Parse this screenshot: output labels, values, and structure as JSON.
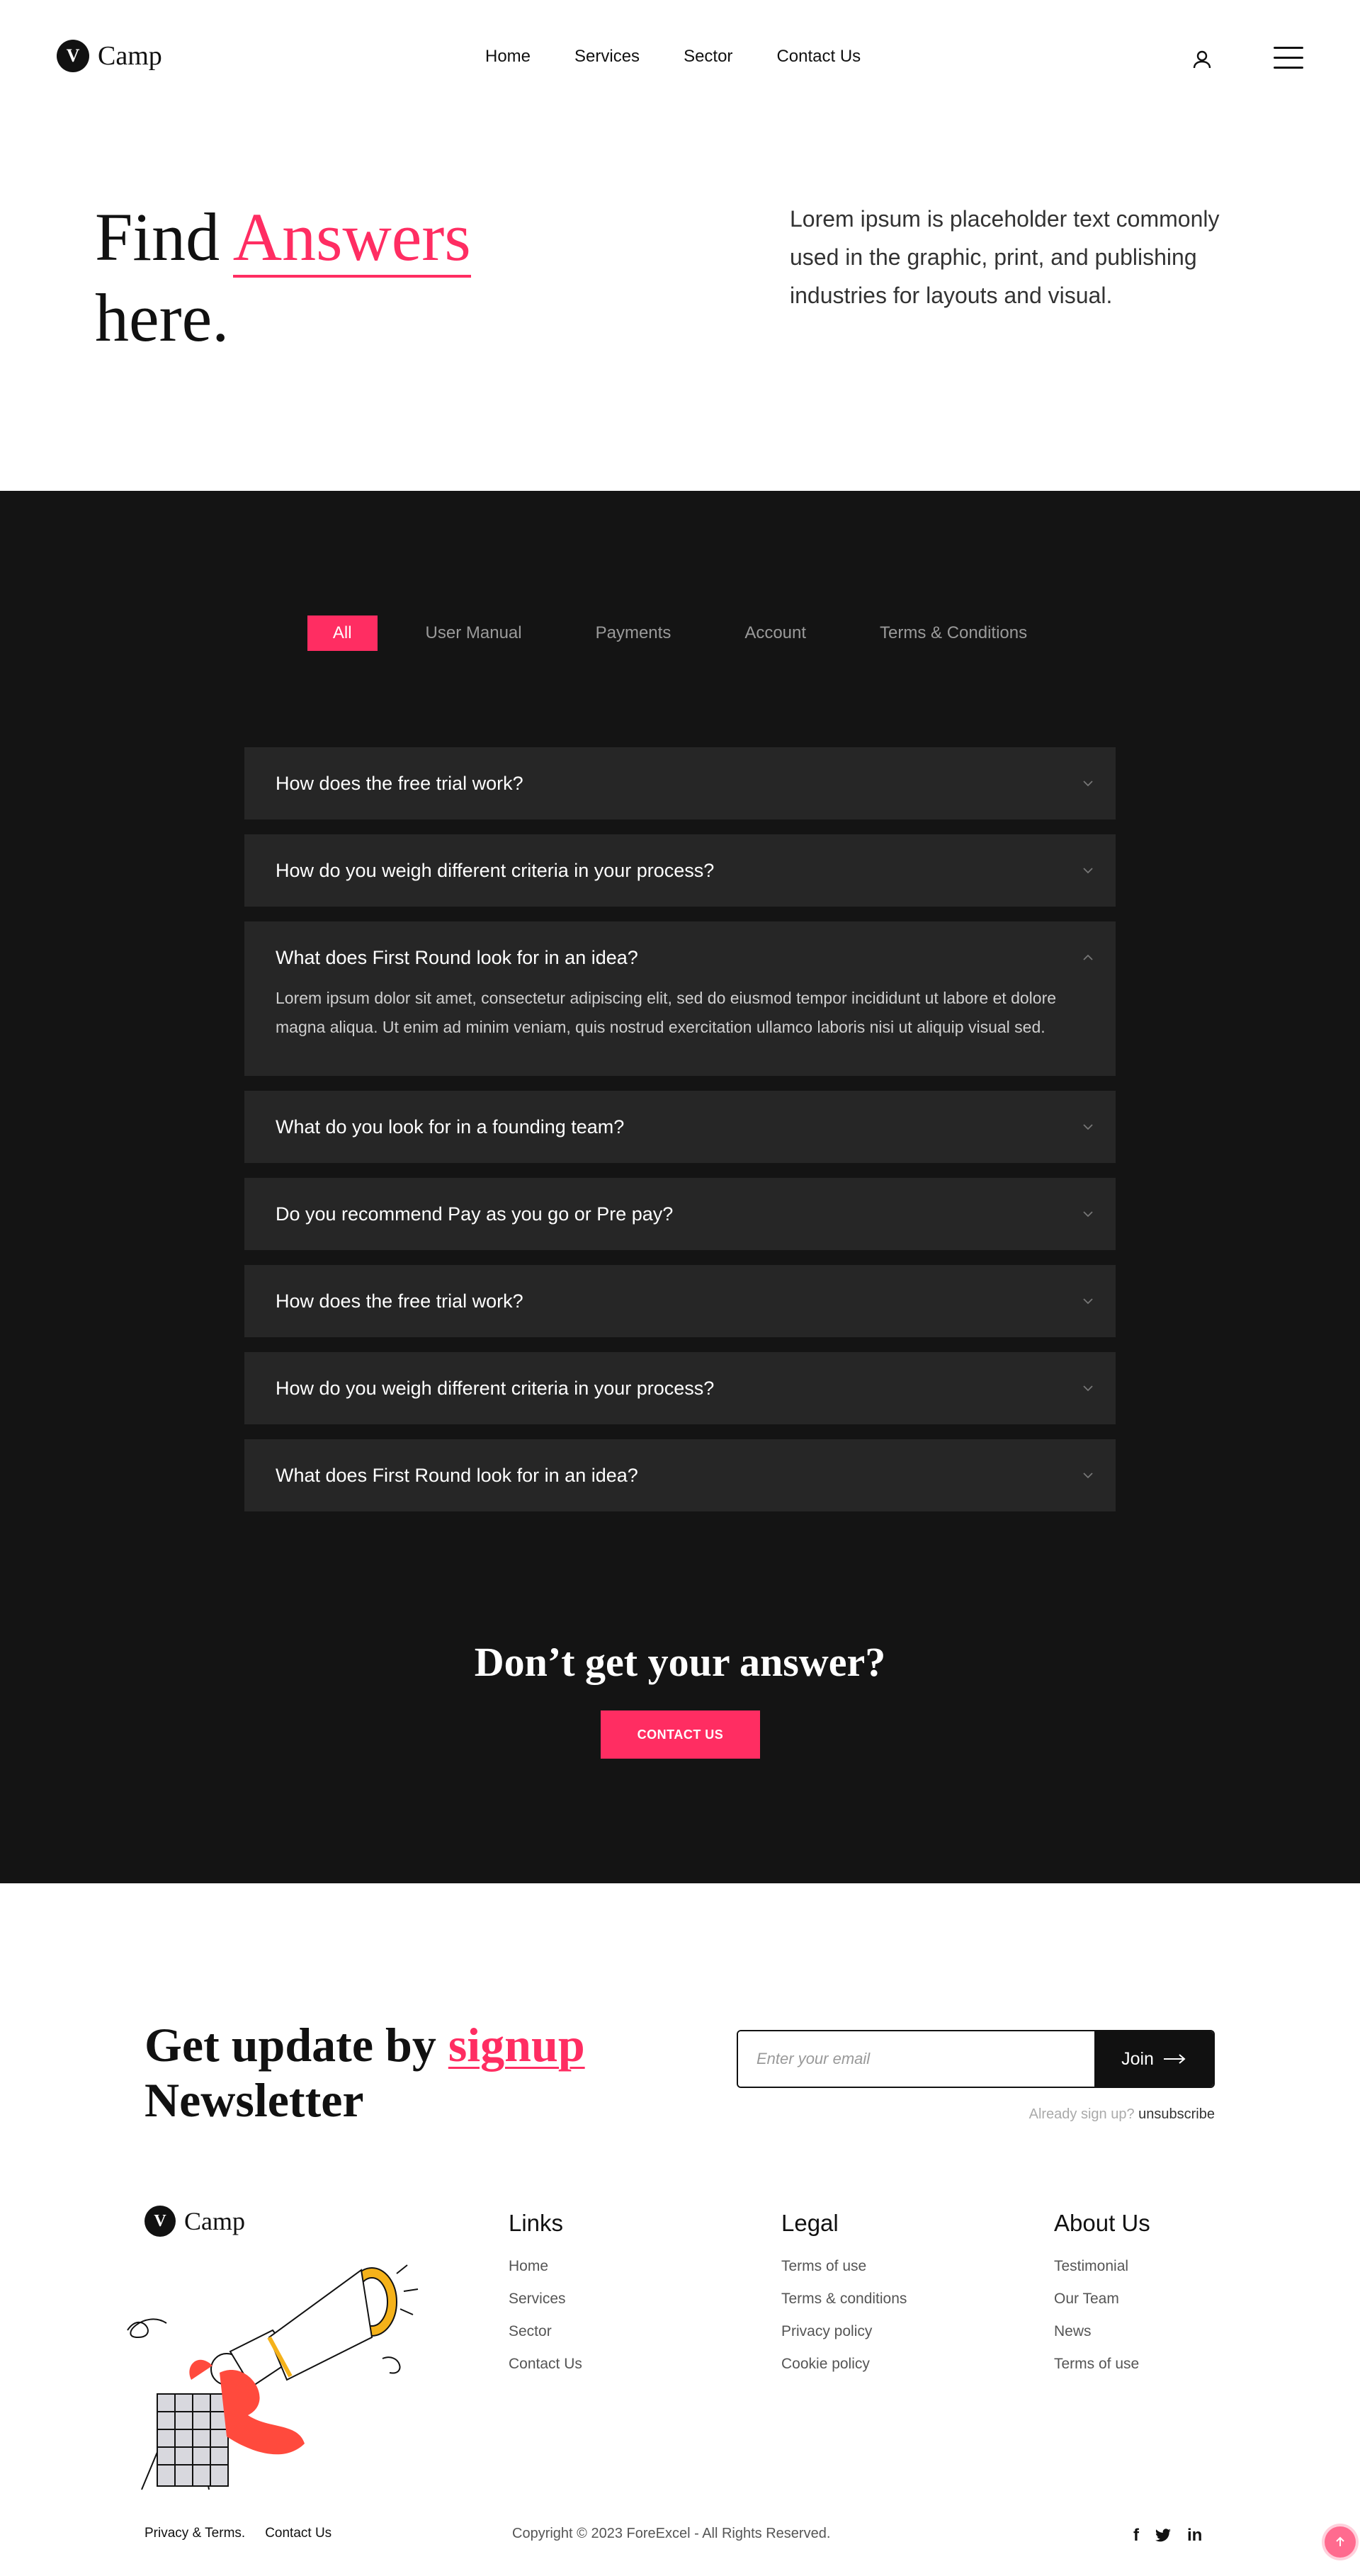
{
  "header": {
    "logo_letter": "V",
    "logo_text": "Camp",
    "nav": [
      "Home",
      "Services",
      "Sector",
      "Contact Us"
    ]
  },
  "hero": {
    "title_part1": "Find",
    "title_accent": "Answers",
    "title_part2": "here.",
    "description": "Lorem ipsum is placeholder text commonly used in the graphic, print, and publishing industries for layouts and visual."
  },
  "faq": {
    "tabs": [
      "All",
      "User Manual",
      "Payments",
      "Account",
      "Terms & Conditions"
    ],
    "active_tab": "All",
    "items": [
      {
        "question": "How does the free trial work?",
        "open": false
      },
      {
        "question": "How do you weigh different criteria in your process?",
        "open": false
      },
      {
        "question": "What does First Round look for in an idea?",
        "open": true,
        "answer": "Lorem ipsum dolor sit amet, consectetur adipiscing elit, sed do eiusmod tempor incididunt ut labore et dolore magna aliqua. Ut enim ad minim veniam, quis nostrud exercitation ullamco laboris nisi ut aliquip visual sed."
      },
      {
        "question": "What do you look for in a founding team?",
        "open": false
      },
      {
        "question": "Do you recommend Pay as you go or Pre pay?",
        "open": false
      },
      {
        "question": "How does the free trial work?",
        "open": false
      },
      {
        "question": "How do you weigh different criteria in your process?",
        "open": false
      },
      {
        "question": "What does First Round look for in an idea?",
        "open": false
      }
    ],
    "cta_title": "Don’t get your answer?",
    "cta_button": "CONTACT US"
  },
  "newsletter": {
    "title_part1": "Get update by",
    "title_accent": "signup",
    "title_part2": "Newsletter",
    "email_placeholder": "Enter your email",
    "join_label": "Join",
    "already": "Already sign up?",
    "unsubscribe": "unsubscribe"
  },
  "footer": {
    "logo_letter": "V",
    "logo_text": "Camp",
    "links": {
      "title": "Links",
      "items": [
        "Home",
        "Services",
        "Sector",
        "Contact Us"
      ]
    },
    "legal": {
      "title": "Legal",
      "items": [
        "Terms of use",
        "Terms & conditions",
        "Privacy policy",
        "Cookie policy"
      ]
    },
    "about": {
      "title": "About Us",
      "items": [
        "Testimonial",
        "Our Team",
        "News",
        "Terms of use"
      ]
    },
    "bottom_links": [
      "Privacy & Terms.",
      "Contact Us"
    ],
    "copyright": "Copyright © 2023 ForeExcel - All Rights Reserved.",
    "social": [
      "facebook-icon",
      "twitter-icon",
      "linkedin-icon"
    ]
  },
  "colors": {
    "accent": "#ff2d62",
    "dark": "#141414",
    "card": "#262626"
  }
}
